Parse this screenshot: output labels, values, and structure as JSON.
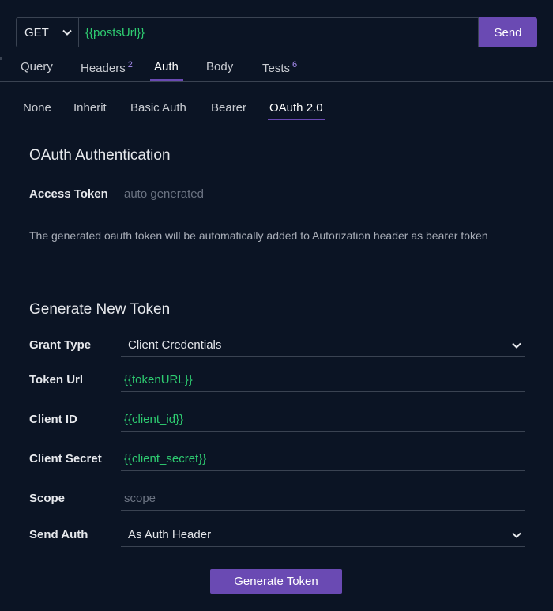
{
  "request": {
    "method": "GET",
    "url": "{{postsUrl}}",
    "send_label": "Send"
  },
  "main_tabs": [
    {
      "label": "Query",
      "badge": ""
    },
    {
      "label": "Headers",
      "badge": "2"
    },
    {
      "label": "Auth",
      "badge": ""
    },
    {
      "label": "Body",
      "badge": ""
    },
    {
      "label": "Tests",
      "badge": "6"
    }
  ],
  "main_tab_active": "Auth",
  "auth_types": [
    "None",
    "Inherit",
    "Basic Auth",
    "Bearer",
    "OAuth 2.0"
  ],
  "auth_type_active": "OAuth 2.0",
  "oauth": {
    "title": "OAuth Authentication",
    "access_token_label": "Access Token",
    "access_token_placeholder": "auto generated",
    "help_text": "The generated oauth token will be automatically added to Autorization header as bearer token"
  },
  "generate": {
    "title": "Generate New Token",
    "grant_type_label": "Grant Type",
    "grant_type_value": "Client Credentials",
    "token_url_label": "Token Url",
    "token_url_value": "{{tokenURL}}",
    "client_id_label": "Client ID",
    "client_id_value": "{{client_id}}",
    "client_secret_label": "Client Secret",
    "client_secret_value": "{{client_secret}}",
    "scope_label": "Scope",
    "scope_placeholder": "scope",
    "send_auth_label": "Send Auth",
    "send_auth_value": "As Auth Header",
    "button_label": "Generate Token"
  },
  "colors": {
    "background": "#0b1424",
    "accent": "#6a4ab3",
    "variable": "#2ecc71",
    "badge": "#a88cf0"
  },
  "icons": {
    "method_dropdown": "chevron-down-icon",
    "grant_dropdown": "chevron-down-icon",
    "send_auth_dropdown": "chevron-down-icon"
  }
}
